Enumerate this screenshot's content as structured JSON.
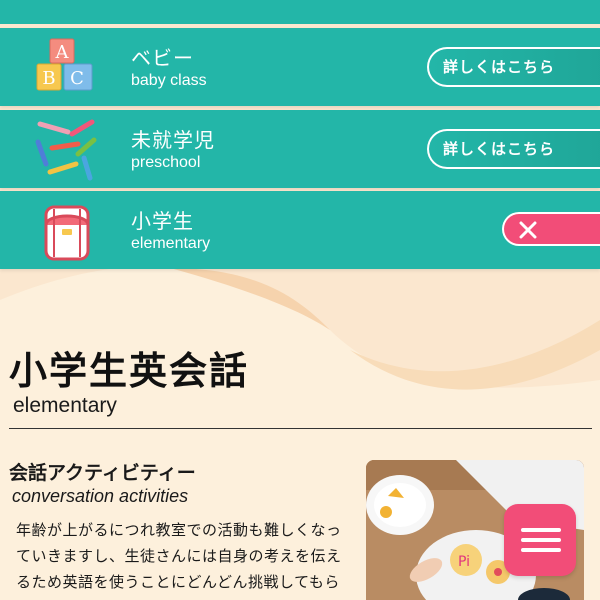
{
  "nav": {
    "items": [
      {
        "title": "ベビー",
        "subtitle": "baby class",
        "icon": "abc-blocks-icon",
        "action": "詳しくはこちら"
      },
      {
        "title": "未就学児",
        "subtitle": "preschool",
        "icon": "crayons-icon",
        "action": "詳しくはこちら"
      },
      {
        "title": "小学生",
        "subtitle": "elementary",
        "icon": "school-backpack-icon",
        "action": "close"
      }
    ]
  },
  "page": {
    "title": "小学生英会話",
    "subtitle": "elementary"
  },
  "section": {
    "title": "会話アクティビティー",
    "subtitle": "conversation activities",
    "body": "年齢が上がるにつれ教室での活動も難しくなっていきますし、生徒さんには自身の考えを伝えるため英語を使うことにどんどん挑戦してもらいます。徐々に小学校から中学校レベル"
  },
  "colors": {
    "teal": "#23b6a8",
    "pink": "#f24d78",
    "cream": "#fbe7cf"
  }
}
